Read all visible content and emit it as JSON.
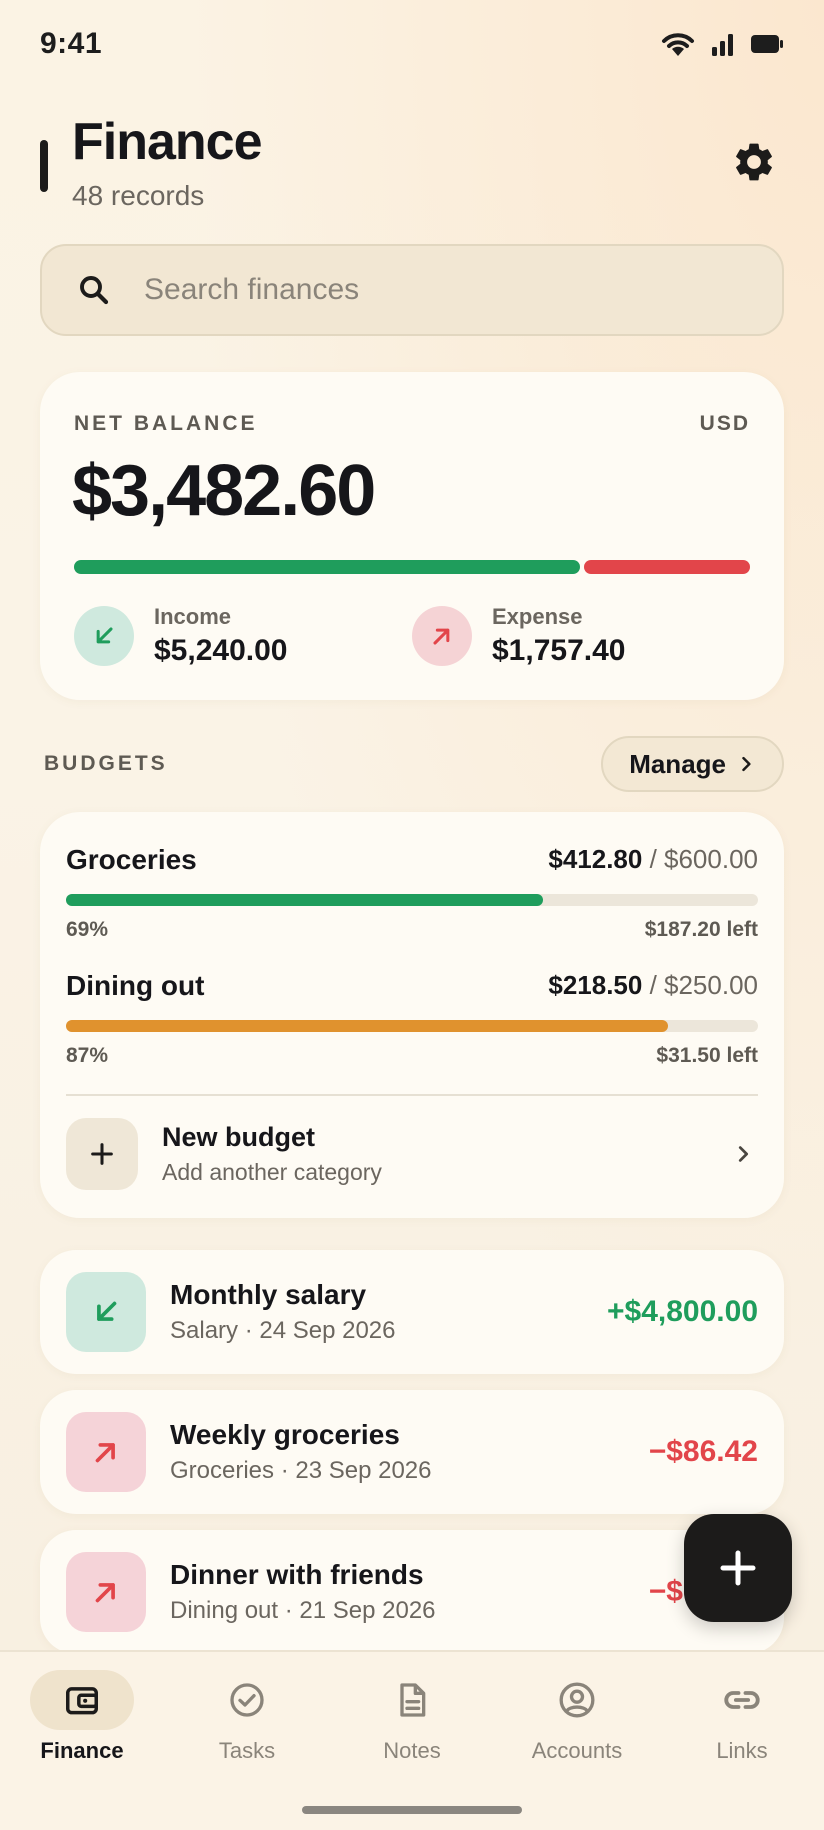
{
  "status": {
    "time": "9:41",
    "icons": [
      "wifi-icon",
      "signal-icon",
      "battery-icon"
    ]
  },
  "header": {
    "title": "Finance",
    "subtitle": "48 records",
    "settings_icon": "gear-icon"
  },
  "search": {
    "placeholder": "Search finances",
    "icon": "search-icon"
  },
  "balance": {
    "label": "NET BALANCE",
    "currency": "USD",
    "value": "$3,482.60",
    "income_ratio": 0.749,
    "income": {
      "label": "Income",
      "value": "$5,240.00"
    },
    "expense": {
      "label": "Expense",
      "value": "$1,757.40"
    }
  },
  "budgets": {
    "section_label": "BUDGETS",
    "manage_label": "Manage",
    "items": [
      {
        "name": "Groceries",
        "spent": "$412.80",
        "limit": " / $600.00",
        "percent": "69%",
        "progress": 0.69,
        "left": "$187.20 left",
        "color": "#1f9d5c"
      },
      {
        "name": "Dining out",
        "spent": "$218.50",
        "limit": " / $250.00",
        "percent": "87%",
        "progress": 0.87,
        "left": "$31.50 left",
        "color": "#e0922e"
      }
    ],
    "new_budget": {
      "title": "New budget",
      "subtitle": "Add another category"
    }
  },
  "transactions": [
    {
      "title": "Monthly salary",
      "subtitle": "Salary · 24 Sep 2026",
      "amount": "+$4,800.00",
      "type": "income"
    },
    {
      "title": "Weekly groceries",
      "subtitle": "Groceries · 23 Sep 2026",
      "amount": "−$86.42",
      "type": "expense"
    },
    {
      "title": "Dinner with friends",
      "subtitle": "Dining out · 21 Sep 2026",
      "amount": "−$64.30",
      "type": "expense"
    }
  ],
  "nav": {
    "items": [
      {
        "label": "Finance",
        "icon": "wallet-icon",
        "active": true
      },
      {
        "label": "Tasks",
        "icon": "check-circle-icon",
        "active": false
      },
      {
        "label": "Notes",
        "icon": "document-icon",
        "active": false
      },
      {
        "label": "Accounts",
        "icon": "user-circle-icon",
        "active": false
      },
      {
        "label": "Links",
        "icon": "link-icon",
        "active": false
      }
    ]
  },
  "colors": {
    "income": "#1f9d5c",
    "expense": "#e2454a",
    "warning": "#e0922e",
    "ink": "#1c1b1a"
  }
}
